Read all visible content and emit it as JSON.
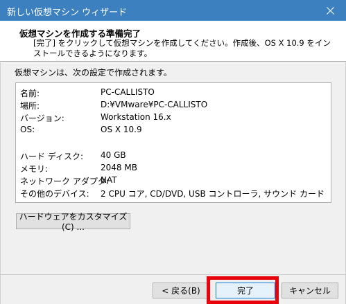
{
  "window": {
    "title": "新しい仮想マシン ウィザード"
  },
  "header": {
    "title": "仮想マシンを作成する準備完了",
    "description": "[完了] をクリックして仮想マシンを作成してください。作成後、OS X 10.9 をインストールできるようになります。"
  },
  "intro": "仮想マシンは、次の設定で作成されます。",
  "summary": {
    "rows": [
      {
        "label": "名前:",
        "value": "PC-CALLISTO"
      },
      {
        "label": "場所:",
        "value": "D:¥VMware¥PC-CALLISTO"
      },
      {
        "label": "バージョン:",
        "value": "Workstation 16.x"
      },
      {
        "label": "OS:",
        "value": "OS X 10.9"
      },
      {
        "label": "ハード ディスク:",
        "value": "40 GB"
      },
      {
        "label": "メモリ:",
        "value": "2048 MB"
      },
      {
        "label": "ネットワーク アダプタ:",
        "value": "NAT"
      },
      {
        "label": "その他のデバイス:",
        "value": "2 CPU コア, CD/DVD, USB コントローラ, サウンド カード"
      }
    ]
  },
  "buttons": {
    "customize": "ハードウェアをカスタマイズ(C) ...",
    "back": "< 戻る(B)",
    "finish": "完了",
    "cancel": "キャンセル"
  },
  "colors": {
    "titlebar": "#3c80bf",
    "highlight": "#e8000b"
  },
  "icons": {
    "close": "close-icon"
  }
}
